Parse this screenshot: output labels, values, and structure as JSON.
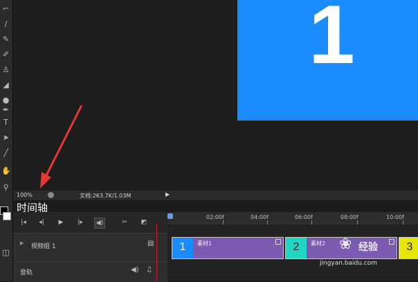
{
  "canvas": {
    "artwork_number": "1",
    "artwork_color": "#1a8cff"
  },
  "status_bar": {
    "zoom": "100%",
    "doc_info": "文档:263.7K/1.03M",
    "menu_arrow": "▶"
  },
  "annotation": {
    "text": "时间轴",
    "arrow_color": "#e53935"
  },
  "timeline": {
    "controls": [
      {
        "icon": "first-frame-icon",
        "glyph": "|◂"
      },
      {
        "icon": "prev-frame-icon",
        "glyph": "◂|"
      },
      {
        "icon": "play-icon",
        "glyph": "▶"
      },
      {
        "icon": "next-frame-icon",
        "glyph": "|▸"
      },
      {
        "icon": "audio-icon",
        "glyph": "◀)"
      },
      {
        "icon": "split-scissors-icon",
        "glyph": "✂"
      },
      {
        "icon": "transition-icon",
        "glyph": "◩"
      }
    ],
    "ruler_labels": [
      "02:00f",
      "04:00f",
      "06:00f",
      "08:00f",
      "10:00f"
    ],
    "video_group": {
      "label": "视频组 1",
      "clips": [
        {
          "thumb": "1",
          "label": "素材1",
          "thumb_color": "#1a8cff",
          "body_color": "#7a5bb0"
        },
        {
          "thumb": "2",
          "label": "素材2",
          "thumb_color": "#1fd6c5",
          "body_color": "#7a5bb0"
        },
        {
          "thumb": "3",
          "label": "",
          "thumb_color": "#e6e600",
          "body_color": "#7a5bb0"
        }
      ]
    },
    "audio_track": {
      "label": "音轨"
    }
  },
  "watermark": {
    "name": "经验",
    "url": "jingyan.baidu.com"
  }
}
